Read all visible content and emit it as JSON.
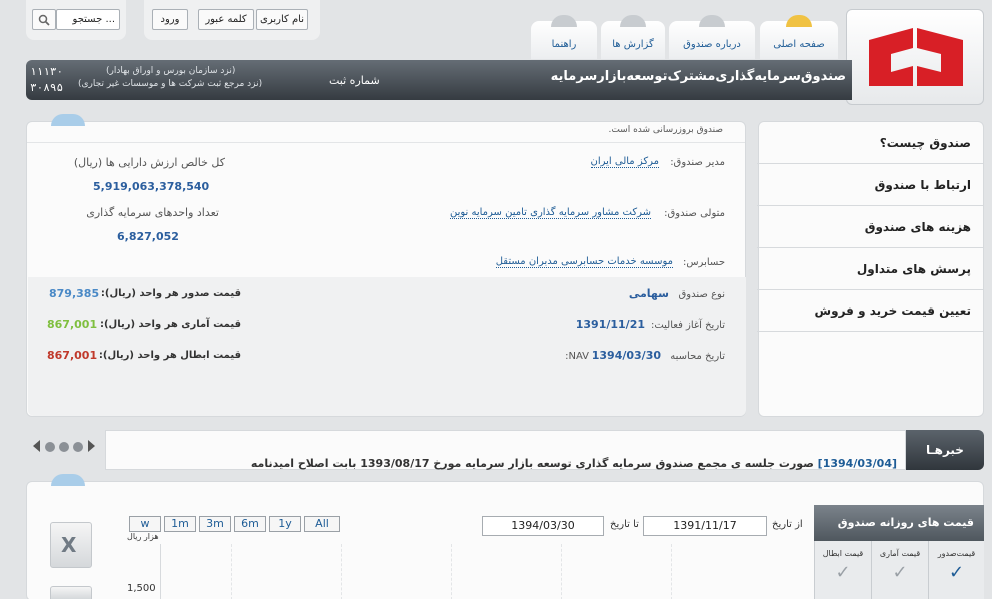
{
  "header": {
    "search": {
      "button_icon": "search-icon",
      "placeholder": "جستجو ..."
    },
    "login": {
      "username_placeholder": "نام کاربری",
      "password_placeholder": "کلمه عبور",
      "login_label": "ورود"
    }
  },
  "nav": {
    "tabs": [
      {
        "label": "صفحه اصلی"
      },
      {
        "label": "درباره صندوق"
      },
      {
        "label": "گزارش ها"
      },
      {
        "label": "راهنما"
      }
    ]
  },
  "title": {
    "fund_name": "صندوق‌سرمایه‌گذاری‌مشترک‌توسعه‌بازارسرمایه",
    "registration_label": "شماره ثبت",
    "reg_sec_label": "(نزد سازمان بورس و اوراق بهادار)",
    "reg_company_label": "(نزد مرجع ثبت شرکت ها و موسسات غیر تجاری)",
    "reg_sec_number": "۱۱۱۳۰",
    "reg_company_number": "۳۰۸۹۵"
  },
  "sidebar": {
    "items": [
      {
        "label": "صندوق چیست؟"
      },
      {
        "label": "ارتباط با صندوق"
      },
      {
        "label": "هزینه های صندوق"
      },
      {
        "label": "پرسش های متداول"
      },
      {
        "label": "تعیین قیمت خرید و فروش"
      }
    ]
  },
  "info": {
    "update_note": "صندوق بروزرسانی شده است.",
    "manager_label": "مدیر صندوق:",
    "manager_value": "مرکز مالی ایران",
    "custodian_label": "متولی صندوق:",
    "custodian_value": "شرکت مشاور سرمایه گذاری تامین سرمایه نوین",
    "auditor_label": "حسابرس:",
    "auditor_value": "موسسه خدمات حسابرسی مدبران مستقل",
    "nav_total_label": "کل خالص ارزش دارایی ها (ریال)",
    "nav_total_value": "5,919,063,378,540",
    "units_label": "تعداد واحدهای سرمایه گذاری",
    "units_value": "6,827,052",
    "fund_type_label": "نوع صندوق",
    "fund_type_value": "سهامی",
    "start_date_label": "تاریخ آغاز فعالیت:",
    "start_date_value": "1391/11/21",
    "nav_date_label": "تاریخ محاسبه",
    "nav_date_suffix": "NAV:",
    "nav_date_value": "1394/03/30",
    "issue_price_label": "قیمت صدور هر واحد (ریال):",
    "issue_price_value": "879,385",
    "stat_price_label": "قیمت آماری هر واحد (ریال):",
    "stat_price_value": "867,001",
    "redeem_price_label": "قیمت ابطال هر واحد (ریال):",
    "redeem_price_value": "867,001"
  },
  "news": {
    "title": "خبرهـا",
    "item_date": "[1394/03/04]",
    "item_text": "صورت جلسه ی مجمع صندوق سرمایه گذاری توسعه بازار سرمایه مورخ 1393/08/17 بابت اصلاح امیدنامه"
  },
  "chart_panel": {
    "ranges": [
      "w",
      "1m",
      "3m",
      "6m",
      "1y",
      "All"
    ],
    "from_label": "از تاریخ",
    "from_date": "1391/11/17",
    "to_label": "تا تاریخ",
    "to_date": "1394/03/30",
    "y_unit": "هزار ریال",
    "y_tick": "1,500",
    "daily_title": "قیمت های روزانه صندوق",
    "cols": [
      "قیمت‌صدور",
      "قیمت آماری",
      "قیمت ابطال"
    ]
  },
  "colors": {
    "accent_blue": "#1e5c96",
    "price_issue": "#4a89c6",
    "price_stat": "#7fbf3f",
    "price_redeem": "#c0392b",
    "logo_red": "#d81f26"
  }
}
